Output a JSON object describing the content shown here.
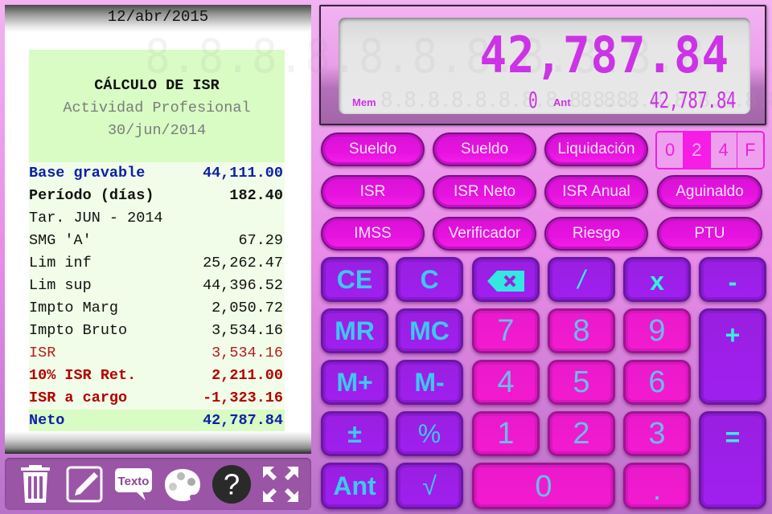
{
  "paper": {
    "date": "12/abr/2015",
    "title": "CÁLCULO DE ISR",
    "subtitle": "Actividad Profesional",
    "period_date": "30/jun/2014",
    "rows": [
      {
        "label": "Base gravable",
        "value": "44,111.00",
        "style": "blue bold"
      },
      {
        "label": "Período (días)",
        "value": "182.40",
        "style": "black bold"
      },
      {
        "label": "Tar. JUN - 2014",
        "value": "",
        "style": "black"
      },
      {
        "label": "SMG 'A'",
        "value": "67.29",
        "style": "black"
      },
      {
        "label": "Lim inf",
        "value": "25,262.47",
        "style": "black"
      },
      {
        "label": "Lim sup",
        "value": "44,396.52",
        "style": "black"
      },
      {
        "label": "Impto Marg",
        "value": "2,050.72",
        "style": "black"
      },
      {
        "label": "Impto Bruto",
        "value": "3,534.16",
        "style": "black"
      },
      {
        "label": "ISR",
        "value": "3,534.16",
        "style": "red"
      },
      {
        "label": "10% ISR Ret.",
        "value": "2,211.00",
        "style": "darkred bold"
      },
      {
        "label": "ISR a cargo",
        "value": "-1,323.16",
        "style": "darkred bold"
      }
    ],
    "neto": {
      "label": "Neto",
      "value": "42,787.84"
    }
  },
  "toolbar": {
    "items": [
      {
        "name": "trash",
        "label": ""
      },
      {
        "name": "edit",
        "label": ""
      },
      {
        "name": "text",
        "label": "Texto"
      },
      {
        "name": "palette",
        "label": ""
      },
      {
        "name": "help",
        "label": "?"
      },
      {
        "name": "expand",
        "label": ""
      }
    ]
  },
  "display": {
    "main": "42,787.84",
    "main_ghost": "8.8.8.8.8.8.8.8.8.8.8.",
    "mem_label": "Mem",
    "mem_value": "0",
    "mem_ghost": "8.8.8.8.8.8.8.8.8.8.8.",
    "ant_label": "Ant",
    "ant_value": "42,787.84",
    "ant_ghost": "8.8.8.8.8.8.8.8.8.8.8."
  },
  "functions": {
    "row1": [
      "Sueldo",
      "Sueldo",
      "Liquidación"
    ],
    "row2": [
      "ISR",
      "ISR Neto",
      "ISR Anual",
      "Aguinaldo"
    ],
    "row3": [
      "IMSS",
      "Verificador",
      "Riesgo",
      "PTU"
    ]
  },
  "decimals": {
    "options": [
      "0",
      "2",
      "4",
      "F"
    ],
    "selected": "2"
  },
  "keypad": {
    "ce": "CE",
    "c": "C",
    "backspace": "⌫",
    "divide": "/",
    "multiply": "x",
    "minus": "-",
    "mr": "MR",
    "mc": "MC",
    "seven": "7",
    "eight": "8",
    "nine": "9",
    "plus": "+",
    "mplus": "M+",
    "mminus": "M-",
    "four": "4",
    "five": "5",
    "six": "6",
    "plusminus": "±",
    "percent": "%",
    "one": "1",
    "two": "2",
    "three": "3",
    "equals": "=",
    "ant": "Ant",
    "sqrt": "√",
    "zero": "0",
    "dot": "."
  },
  "colors": {
    "background": "#e88ce8",
    "lcd_digits": "#cc33e6",
    "function_button": "#e613e0",
    "operator_key": "#a01ff0",
    "number_key": "#f41ad0",
    "key_text": "#3cc8f2"
  }
}
